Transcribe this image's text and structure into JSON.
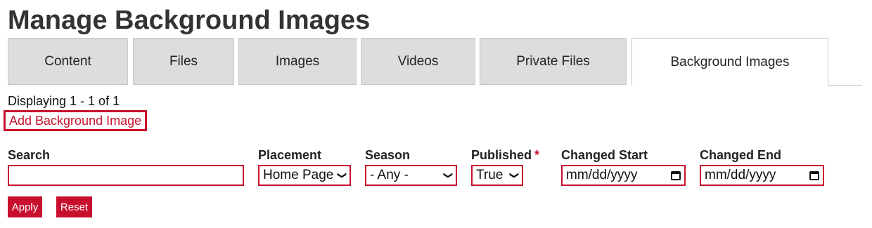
{
  "page": {
    "title": "Manage Background Images"
  },
  "tabs": [
    {
      "label": "Content"
    },
    {
      "label": "Files"
    },
    {
      "label": "Images"
    },
    {
      "label": "Videos"
    },
    {
      "label": "Private Files"
    },
    {
      "label": "Background Images",
      "active": true
    }
  ],
  "summary": {
    "displaying": "Displaying 1 - 1 of 1"
  },
  "actions": {
    "add_label": "Add Background Image"
  },
  "filters": {
    "search": {
      "label": "Search",
      "value": ""
    },
    "placement": {
      "label": "Placement",
      "value": "Home Page"
    },
    "season": {
      "label": "Season",
      "value": "- Any -"
    },
    "published": {
      "label": "Published",
      "required_mark": "*",
      "value": "True"
    },
    "changed_start": {
      "label": "Changed Start",
      "placeholder": "mm/dd/yyyy"
    },
    "changed_end": {
      "label": "Changed End",
      "placeholder": "mm/dd/yyyy"
    }
  },
  "buttons": {
    "apply": "Apply",
    "reset": "Reset"
  },
  "colors": {
    "accent": "#c8102e",
    "tab_bg": "#dddddd"
  }
}
